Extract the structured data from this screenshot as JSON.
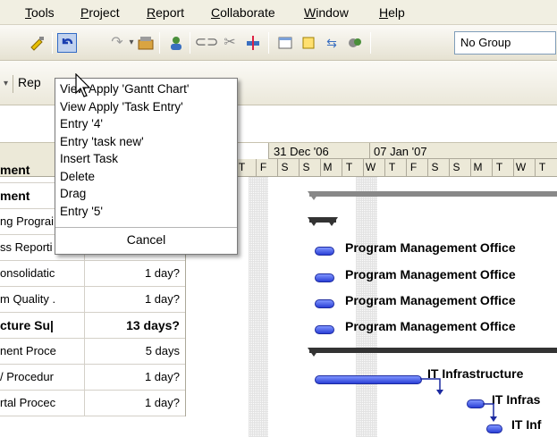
{
  "menubar": {
    "items": [
      {
        "label": "Tools"
      },
      {
        "label": "Project"
      },
      {
        "label": "Report"
      },
      {
        "label": "Collaborate"
      },
      {
        "label": "Window"
      },
      {
        "label": "Help"
      }
    ]
  },
  "toolbar": {
    "group_select_value": "No Group",
    "icons": [
      "format-painter-icon",
      "undo-icon",
      "redo-icon",
      "insert-hyperlink-icon",
      "assign-resources-icon",
      "link-tasks-icon",
      "unlink-tasks-icon",
      "split-task-icon",
      "task-information-icon",
      "task-notes-icon",
      "publish-icon",
      "resource-sharing-icon"
    ]
  },
  "toolbar2": {
    "partial_label": "Rep"
  },
  "undo_list": {
    "items": [
      "View Apply 'Gantt Chart'",
      "View Apply 'Task Entry'",
      "Entry '4'",
      "Entry 'task new'",
      "Insert Task",
      "Delete",
      "Drag",
      "Entry '5'"
    ],
    "cancel_label": "Cancel"
  },
  "timescale": {
    "weeks": [
      "31 Dec '06",
      "07 Jan '07"
    ],
    "days": [
      "T",
      "F",
      "S",
      "S",
      "M",
      "T",
      "W",
      "T",
      "F",
      "S",
      "S",
      "M",
      "T",
      "W",
      "T"
    ]
  },
  "table": {
    "rows": [
      {
        "name": "ment",
        "duration": "",
        "bold": true
      },
      {
        "name": "ment",
        "duration": "",
        "bold": true
      },
      {
        "name": "ng Prograi",
        "duration": "1 day?",
        "bold": false
      },
      {
        "name": "ss Reporti",
        "duration": "1 day?",
        "bold": false
      },
      {
        "name": "onsolidatic",
        "duration": "1 day?",
        "bold": false
      },
      {
        "name": "m Quality .",
        "duration": "1 day?",
        "bold": false
      },
      {
        "name": "cture Su|",
        "duration": "13 days?",
        "bold": true
      },
      {
        "name": "nent Proce",
        "duration": "5 days",
        "bold": false
      },
      {
        "name": "/ Procedur",
        "duration": "1 day?",
        "bold": false
      },
      {
        "name": "rtal Procec",
        "duration": "1 day?",
        "bold": false
      }
    ]
  },
  "gantt": {
    "labels": {
      "pmo": "Program Management Office",
      "it1": "IT Infrastructure",
      "it2": "IT Infras",
      "it3": "IT Inf"
    }
  },
  "colors": {
    "menubar_bg": "#f1efe2",
    "task_bar": "#3a50e0",
    "summary_bar": "#333333"
  }
}
